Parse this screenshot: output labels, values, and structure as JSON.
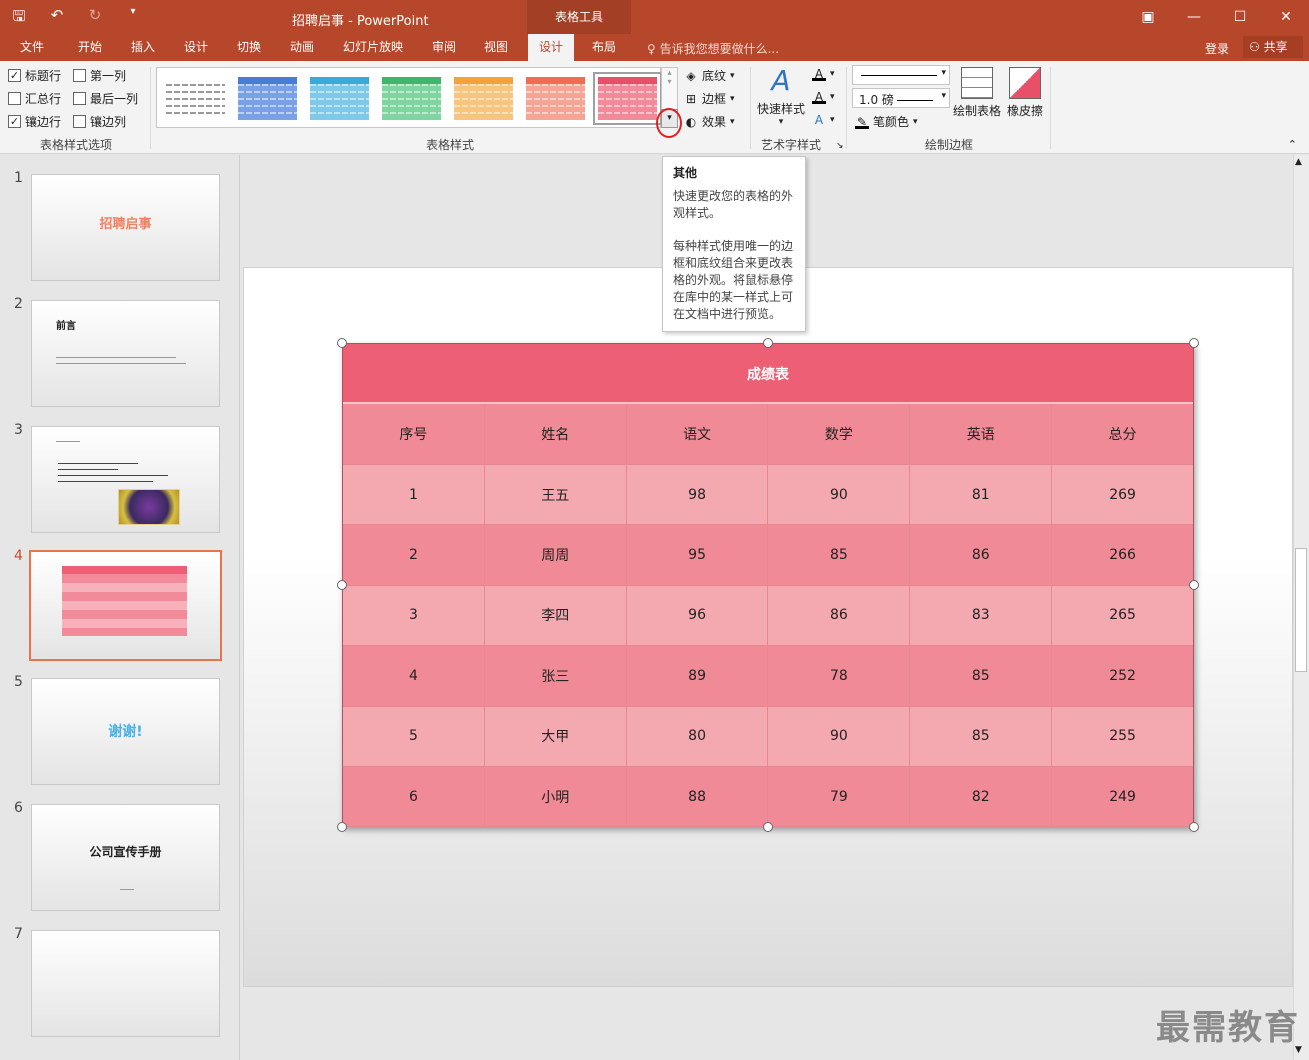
{
  "window": {
    "doc_title": "招聘启事 - PowerPoint",
    "tools_tab": "表格工具",
    "controls": [
      "▣",
      "—",
      "☐",
      "✕"
    ]
  },
  "tabs": [
    {
      "label": "文件",
      "active": false
    },
    {
      "label": "开始",
      "active": false
    },
    {
      "label": "插入",
      "active": false
    },
    {
      "label": "设计",
      "active": false
    },
    {
      "label": "切换",
      "active": false
    },
    {
      "label": "动画",
      "active": false
    },
    {
      "label": "幻灯片放映",
      "active": false
    },
    {
      "label": "审阅",
      "active": false
    },
    {
      "label": "视图",
      "active": false
    },
    {
      "label": "设计",
      "active": true
    },
    {
      "label": "布局",
      "active": false
    }
  ],
  "tellme": "告诉我您想要做什么...",
  "login": "登录",
  "share": "共享",
  "ribbon": {
    "options": [
      {
        "label": "标题行",
        "checked": true
      },
      {
        "label": "第一列",
        "checked": false
      },
      {
        "label": "汇总行",
        "checked": false
      },
      {
        "label": "最后一列",
        "checked": false
      },
      {
        "label": "镶边行",
        "checked": true
      },
      {
        "label": "镶边列",
        "checked": false
      }
    ],
    "options_group": "表格样式选项",
    "styles_group": "表格样式",
    "styles": [
      {
        "color": "#555555",
        "fill": "#ffffff"
      },
      {
        "color": "#4a7bd8",
        "fill": "#7aa0e6"
      },
      {
        "color": "#3aa8d8",
        "fill": "#7ec8ea"
      },
      {
        "color": "#3fb56e",
        "fill": "#7fd4a0"
      },
      {
        "color": "#f2a33a",
        "fill": "#f7c57d"
      },
      {
        "color": "#ee6e55",
        "fill": "#f5a595"
      },
      {
        "color": "#e8506a",
        "fill": "#f28a9a"
      }
    ],
    "shading": "底纹",
    "borders": "边框",
    "effects": "效果",
    "quick_styles": "快速样式",
    "wordart_group": "艺术字样式",
    "pen_weight": "1.0 磅",
    "pen_color": "笔颜色",
    "draw_table": "绘制表格",
    "eraser": "橡皮擦",
    "draw_borders_group": "绘制边框"
  },
  "tooltip": {
    "title": "其他",
    "p1": "快速更改您的表格的外观样式。",
    "p2": "每种样式使用唯一的边框和底纹组合来更改表格的外观。将鼠标悬停在库中的某一样式上可在文档中进行预览。"
  },
  "slides": [
    {
      "num": "1",
      "title": "招聘启事"
    },
    {
      "num": "2",
      "title": "前言"
    },
    {
      "num": "3",
      "title": ""
    },
    {
      "num": "4",
      "title": ""
    },
    {
      "num": "5",
      "title": "谢谢!"
    },
    {
      "num": "6",
      "title": "公司宣传手册"
    },
    {
      "num": "7",
      "title": ""
    }
  ],
  "table": {
    "title": "成绩表",
    "headers": [
      "序号",
      "姓名",
      "语文",
      "数学",
      "英语",
      "总分"
    ],
    "rows": [
      [
        "1",
        "王五",
        "98",
        "90",
        "81",
        "269"
      ],
      [
        "2",
        "周周",
        "95",
        "85",
        "86",
        "266"
      ],
      [
        "3",
        "李四",
        "96",
        "86",
        "83",
        "265"
      ],
      [
        "4",
        "张三",
        "89",
        "78",
        "85",
        "252"
      ],
      [
        "5",
        "大甲",
        "80",
        "90",
        "85",
        "255"
      ],
      [
        "6",
        "小明",
        "88",
        "79",
        "82",
        "249"
      ]
    ]
  },
  "watermark": "最需教育"
}
